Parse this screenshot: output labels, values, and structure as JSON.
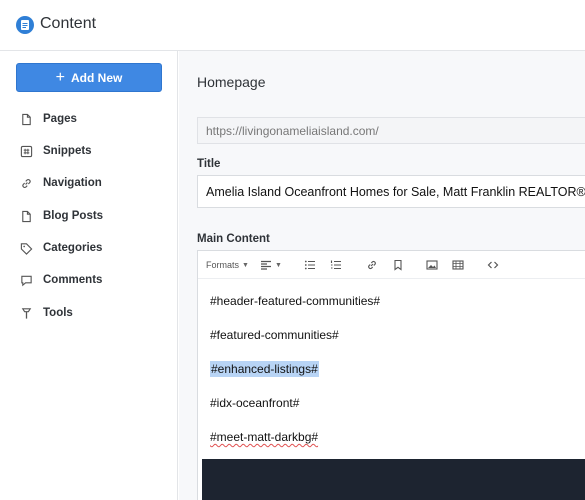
{
  "app": {
    "title": "Content"
  },
  "sidebar": {
    "add_label": "Add New",
    "items": [
      {
        "label": "Pages",
        "icon": "file-icon"
      },
      {
        "label": "Snippets",
        "icon": "hash-icon"
      },
      {
        "label": "Navigation",
        "icon": "link-icon"
      },
      {
        "label": "Blog Posts",
        "icon": "file-icon"
      },
      {
        "label": "Categories",
        "icon": "tag-icon"
      },
      {
        "label": "Comments",
        "icon": "comment-icon"
      },
      {
        "label": "Tools",
        "icon": "wrench-icon"
      }
    ]
  },
  "main": {
    "heading": "Homepage",
    "url": "https://livingonameliaisland.com/",
    "title_label": "Title",
    "title_value": "Amelia Island Oceanfront Homes for Sale, Matt Franklin REALTOR®",
    "content_label": "Main Content",
    "toolbar": {
      "formats_label": "Formats"
    },
    "lines": [
      "#header-featured-communities#",
      "#featured-communities#",
      "#enhanced-listings#",
      "#idx-oceanfront#",
      "#meet-matt-darkbg#"
    ]
  },
  "colors": {
    "accent": "#3f88e3",
    "highlight": "#b8d4f5",
    "dark_block": "#1d2430"
  }
}
